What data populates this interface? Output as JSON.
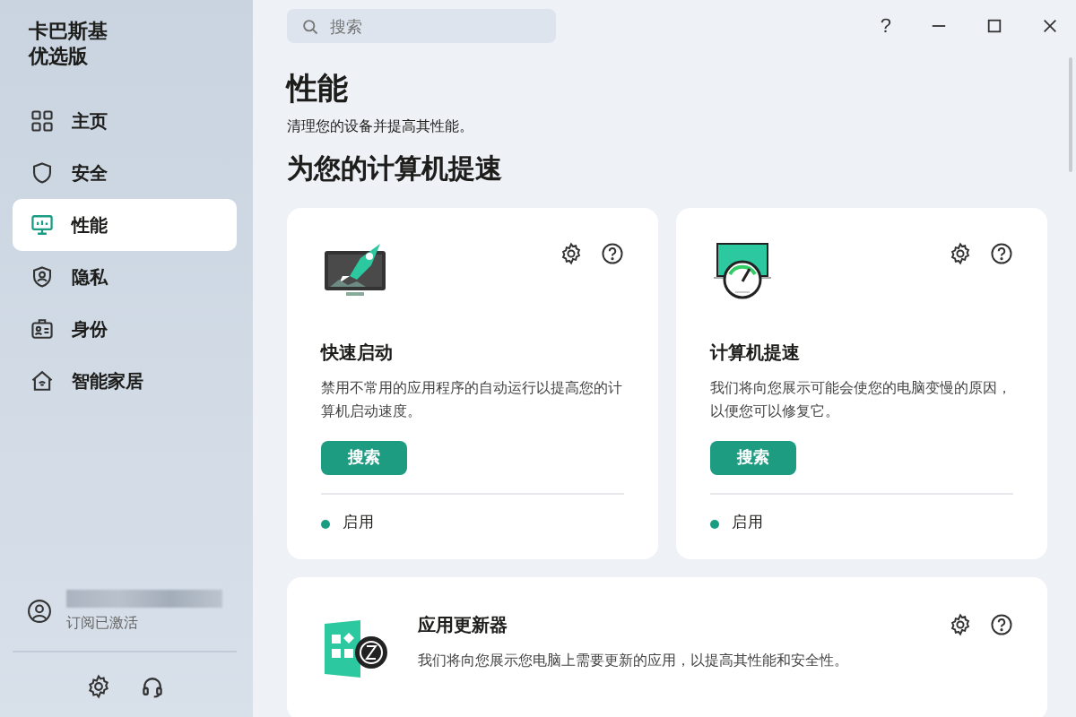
{
  "sidebar": {
    "title": "卡巴斯基优选版",
    "items": [
      {
        "label": "主页",
        "kind": "grid",
        "selected": false
      },
      {
        "label": "安全",
        "kind": "shield",
        "selected": false
      },
      {
        "label": "性能",
        "kind": "monitor",
        "selected": true
      },
      {
        "label": "隐私",
        "kind": "privacy",
        "selected": false
      },
      {
        "label": "身份",
        "kind": "id",
        "selected": false
      },
      {
        "label": "智能家居",
        "kind": "home",
        "selected": false
      }
    ],
    "account": {
      "status": "订阅已激活"
    }
  },
  "search": {
    "placeholder": "搜索"
  },
  "window_controls": {
    "help": "?"
  },
  "page": {
    "title": "性能",
    "subtitle": "清理您的设备并提高其性能。",
    "section": "为您的计算机提速"
  },
  "cards": [
    {
      "kind": "rocket",
      "title": "快速启动",
      "description": "禁用不常用的应用程序的自动运行以提高您的计算机启动速度。",
      "button": "搜索",
      "status": "启用"
    },
    {
      "kind": "gauge",
      "title": "计算机提速",
      "description": "我们将向您展示可能会使您的电脑变慢的原因，以便您可以修复它。",
      "button": "搜索",
      "status": "启用"
    }
  ],
  "wide_card": {
    "title": "应用更新器",
    "description": "我们将向您展示您电脑上需要更新的应用，以提高其性能和安全性。"
  }
}
